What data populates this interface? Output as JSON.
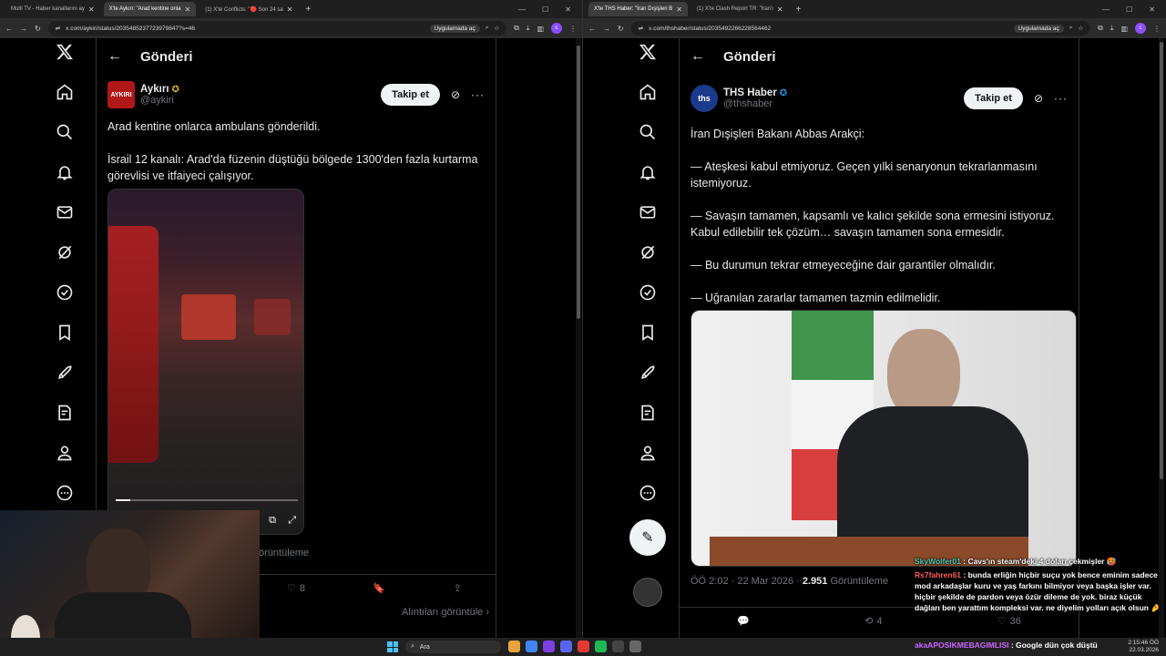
{
  "left_window": {
    "tabs": [
      {
        "label": "Multi TV - Haber kanallarını ay",
        "active": false
      },
      {
        "label": "X'te Aykırı: \"Arad kentine onla",
        "active": true
      },
      {
        "label": "(1) X'te Conflicts: \"🔴 Son 24 sa",
        "active": false
      }
    ],
    "url": "x.com/aykiri/status/2035485237723979847?s=46",
    "open_in_app": "Uygulamada aç",
    "page_title": "Gönderi",
    "post": {
      "display_name": "Aykırı",
      "handle": "@aykiri",
      "avatar_text": "AYKIRI",
      "follow_label": "Takip et",
      "text": [
        "Arad kentine onlarca ambulans gönderildi.",
        "İsrail 12 kanalı: Arad'da füzenin düştüğü bölgede 1300'den fazla kurtarma görevlisi ve itfaiyeci çalışıyor."
      ],
      "views_partial": "örüntüleme",
      "likes": "8",
      "quotes_link": "Alıntıları görüntüle"
    }
  },
  "right_window": {
    "tabs": [
      {
        "label": "X'te THS Haber: \"İran Dışişleri B",
        "active": true
      },
      {
        "label": "(1) X'te Clash Report TR: \"İran'ı",
        "active": false
      }
    ],
    "url": "x.com/thshaber/status/2035492266228564462",
    "open_in_app": "Uygulamada aç",
    "page_title": "Gönderi",
    "post": {
      "display_name": "THS Haber",
      "handle": "@thshaber",
      "avatar_text": "ths",
      "follow_label": "Takip et",
      "text": [
        "İran Dışişleri Bakanı Abbas Arakçi:",
        "— Ateşkesi kabul etmiyoruz. Geçen yılki senaryonun tekrarlanmasını istemiyoruz.",
        "— Savaşın tamamen, kapsamlı ve kalıcı şekilde sona ermesini istiyoruz. Kabul edilebilir tek çözüm… savaşın tamamen sona ermesidir.",
        "— Bu durumun tekrar etmeyeceğine dair garantiler olmalıdır.",
        "— Uğranılan zararlar tamamen tazmin edilmelidir."
      ],
      "timestamp": "ÖÖ 2:02 · 22 Mar 2026 · ",
      "views_count": "2.951",
      "views_label": " Görüntüleme",
      "retweets": "4",
      "likes": "36"
    }
  },
  "chat": [
    {
      "user": "SkyWolfer01",
      "msg": ": Cavs'ın steam'deki 4 doları çekmişler 🥵"
    },
    {
      "user": "Rs7fahren61",
      "msg": ": bunda erliğin hiçbir suçu yok bence eminim sadece mod arkadaşlar kuru ve yaş farkını bilmiyor veya başka işler var. hiçbir şekilde de pardon veya özür dileme de yok. biraz küçük dağları ben yarattım kompleksi var. ne diyelim yolları açık olsun 🤌"
    }
  ],
  "ticker": {
    "user": "akaAPOSIKMEBAGIMLISI",
    "msg": ": Google dün çok düştü"
  },
  "taskbar": {
    "search_placeholder": "Ara",
    "time": "2:15:46 ÖÖ",
    "date": "22.03.2026"
  },
  "colors": {
    "bg": "#000000",
    "text": "#e7e9ea",
    "muted": "#71767b",
    "border": "#2f3336",
    "verified": "#1d9bf0",
    "follow_bg": "#eff3f4"
  }
}
